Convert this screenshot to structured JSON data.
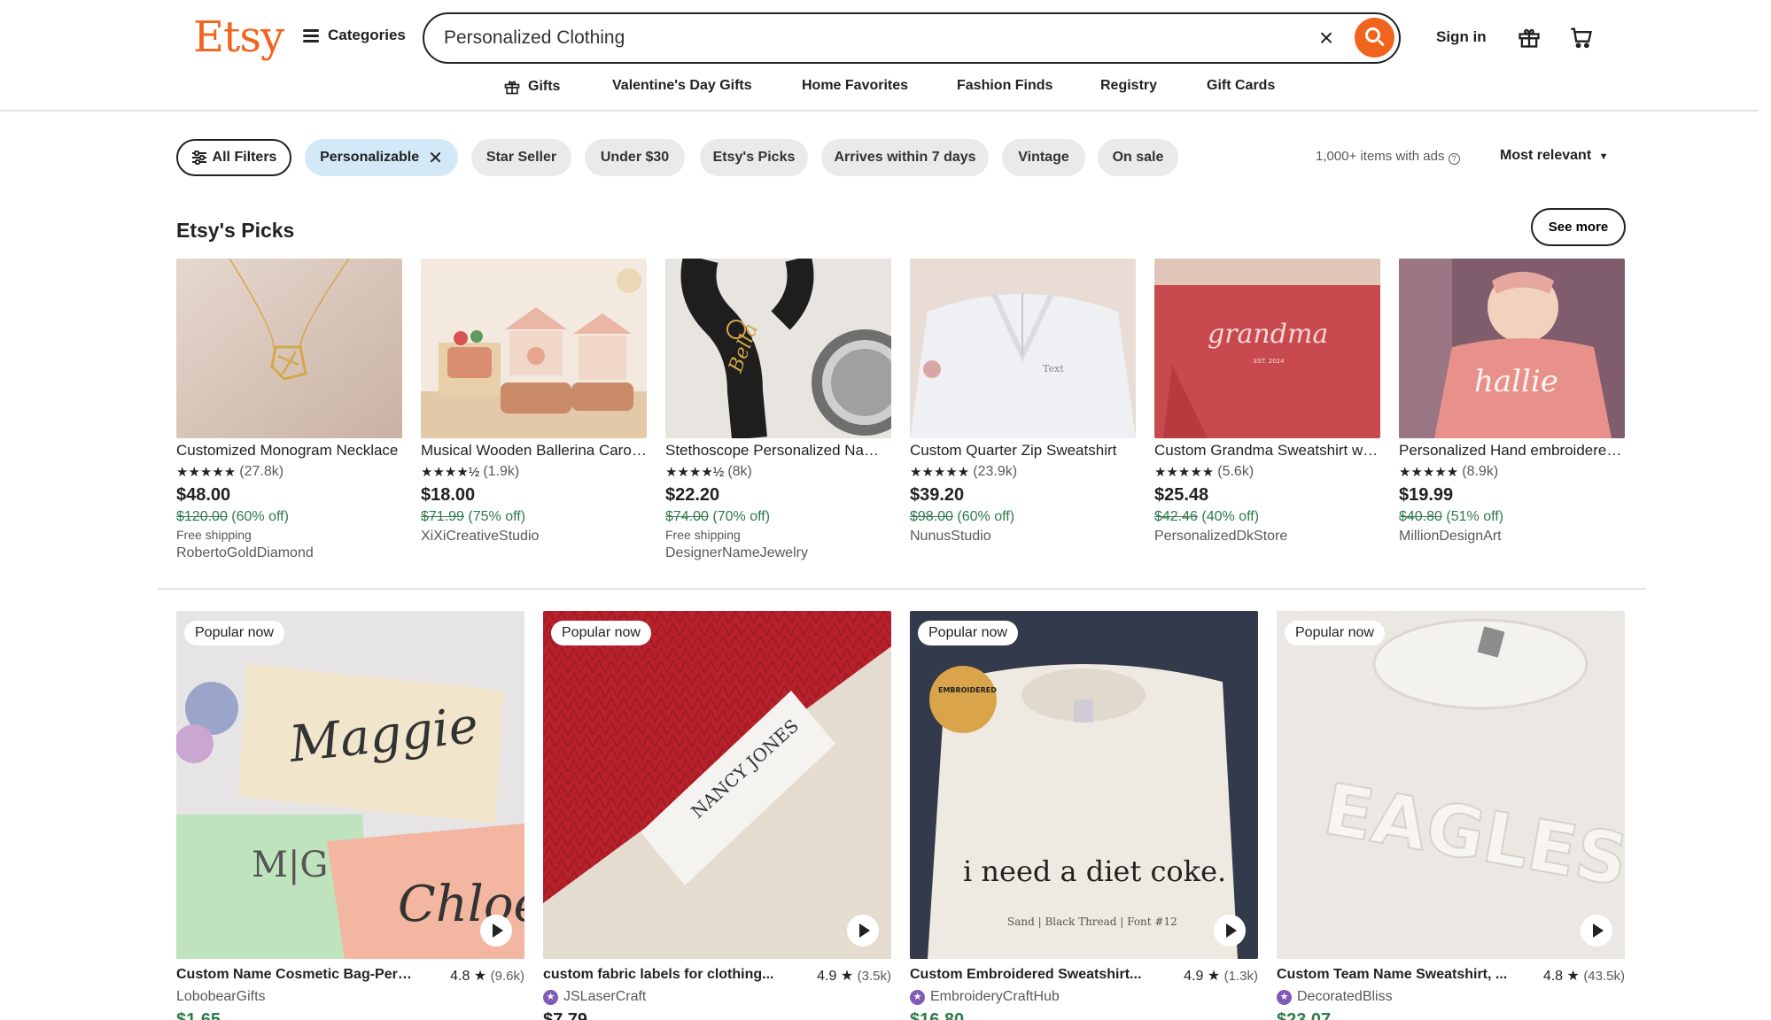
{
  "header": {
    "logo": "Etsy",
    "categories": "Categories",
    "search_value": "Personalized Clothing",
    "sign_in": "Sign in",
    "nav": [
      "Gifts",
      "Valentine's Day Gifts",
      "Home Favorites",
      "Fashion Finds",
      "Registry",
      "Gift Cards"
    ]
  },
  "filters": {
    "all_filters": "All Filters",
    "chips": [
      "Personalizable",
      "Star Seller",
      "Under $30",
      "Etsy's Picks",
      "Arrives within 7 days",
      "Vintage",
      "On sale"
    ],
    "items_count": "1,000+ items with ads",
    "sort": "Most relevant"
  },
  "picks": {
    "title": "Etsy's Picks",
    "see_more": "See more",
    "items": [
      {
        "title": "Customized Monogram Necklace",
        "stars": "★★★★★",
        "reviews": "(27.8k)",
        "price": "$48.00",
        "orig": "$120.00",
        "discount": "(60% off)",
        "shipping": "Free shipping",
        "shop": "RobertoGoldDiamond"
      },
      {
        "title": "Musical Wooden Ballerina Carousel",
        "stars": "★★★★½",
        "reviews": "(1.9k)",
        "price": "$18.00",
        "orig": "$71.99",
        "discount": "(75% off)",
        "shipping": "",
        "shop": "XiXiCreativeStudio"
      },
      {
        "title": "Stethoscope Personalized Name Tag",
        "stars": "★★★★½",
        "reviews": "(8k)",
        "price": "$22.20",
        "orig": "$74.00",
        "discount": "(70% off)",
        "shipping": "Free shipping",
        "shop": "DesignerNameJewelry"
      },
      {
        "title": "Custom Quarter Zip Sweatshirt",
        "stars": "★★★★★",
        "reviews": "(23.9k)",
        "price": "$39.20",
        "orig": "$98.00",
        "discount": "(60% off)",
        "shipping": "",
        "shop": "NunusStudio"
      },
      {
        "title": "Custom Grandma Sweatshirt with Names",
        "stars": "★★★★★",
        "reviews": "(5.6k)",
        "price": "$25.48",
        "orig": "$42.46",
        "discount": "(40% off)",
        "shipping": "",
        "shop": "PersonalizedDkStore"
      },
      {
        "title": "Personalized Hand embroidered Sweater",
        "stars": "★★★★★",
        "reviews": "(8.9k)",
        "price": "$19.99",
        "orig": "$40.80",
        "discount": "(51% off)",
        "shipping": "",
        "shop": "MillionDesignArt"
      }
    ]
  },
  "popular": {
    "badge": "Popular now",
    "items": [
      {
        "title": "Custom Name Cosmetic Bag-Personalized",
        "rating": "4.8",
        "reviews": "(9.6k)",
        "shop": "LobobearGifts",
        "price": "$1.65",
        "star_seller": false
      },
      {
        "title": "custom fabric labels for clothing...",
        "rating": "4.9",
        "reviews": "(3.5k)",
        "shop": "JSLaserCraft",
        "price": "$7.79",
        "star_seller": true
      },
      {
        "title": "Custom Embroidered Sweatshirt...",
        "rating": "4.9",
        "reviews": "(1.3k)",
        "shop": "EmbroideryCraftHub",
        "price": "$16.80",
        "star_seller": true
      },
      {
        "title": "Custom Team Name Sweatshirt, ...",
        "rating": "4.8",
        "reviews": "(43.5k)",
        "shop": "DecoratedBliss",
        "price": "$23.07",
        "star_seller": true
      }
    ],
    "texts": {
      "maggie": "Maggie",
      "mg": "M|G",
      "chloe": "Chloe",
      "nancy": "NANCY JONES",
      "embroidered": "EMBROIDERED",
      "diet": "i need a diet coke.",
      "thread": "Sand | Black Thread | Font #12",
      "eagles": "EAGLES",
      "hallie": "hallie",
      "grandma": "grandma",
      "est": "EST. 2024",
      "bella": "Bella"
    }
  },
  "colors": {
    "brand": "#f1641e",
    "sale": "#2f7a4a",
    "active_chip": "#d4e9f7"
  }
}
